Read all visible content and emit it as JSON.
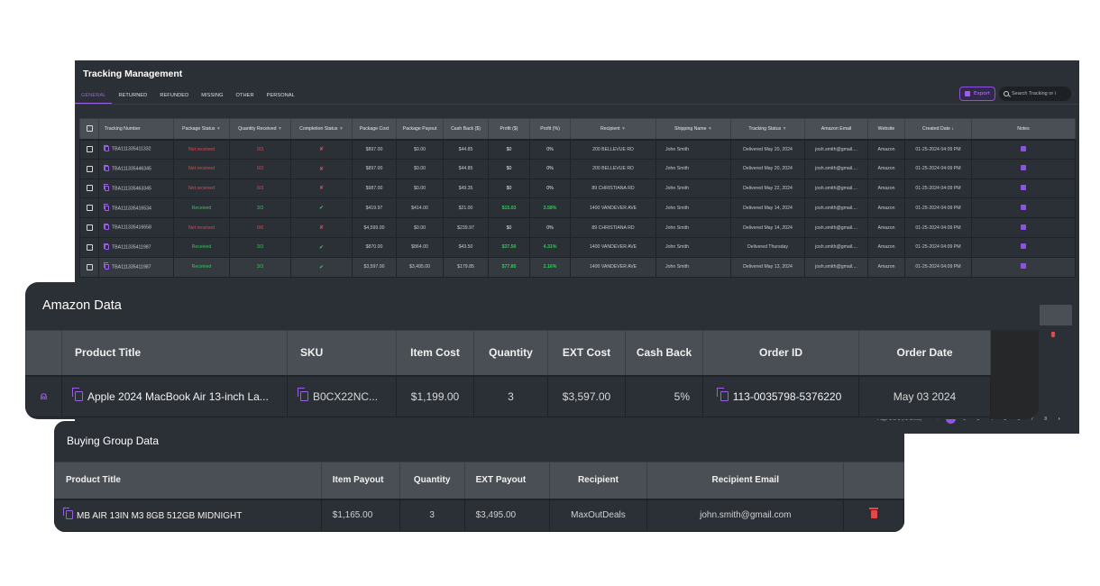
{
  "tracking": {
    "title": "Tracking Management",
    "tabs": [
      {
        "label": "GENERAL",
        "active": true
      },
      {
        "label": "RETURNED",
        "active": false
      },
      {
        "label": "REFUNDED",
        "active": false
      },
      {
        "label": "MISSING",
        "active": false
      },
      {
        "label": "OTHER",
        "active": false
      },
      {
        "label": "PERSONAL",
        "active": false
      }
    ],
    "export_label": "Export",
    "search_placeholder": "Search Tracking or i",
    "columns": [
      "Tracking Number",
      "Package Status",
      "Quantity Received",
      "Completion Status",
      "Package Cost",
      "Package Payout",
      "Cash Back ($)",
      "Profit ($)",
      "Profit (%)",
      "Recipient",
      "Shipping Name",
      "Tracking Status",
      "Amazon Email",
      "Website",
      "Created Date",
      "Notes"
    ],
    "filter_icon": "filter-icon",
    "sort_icon": "↓",
    "rows": [
      {
        "tracking": "TBA111335411332",
        "status": "Not received",
        "qty": "0/3",
        "complete": false,
        "cost": "$897.00",
        "payout": "$0.00",
        "cashback": "$44.85",
        "profit": "$0",
        "profit_pct": "0%",
        "recipient": "200 BELLEVUE RD",
        "ship_name": "John Smith",
        "track_status": "Delivered May 20, 2024",
        "email": "josh.smith@gmail....",
        "website": "Amazon",
        "created": "01-25-2024 04:09 PM"
      },
      {
        "tracking": "TBA111335446345",
        "status": "Not received",
        "qty": "0/3",
        "complete": false,
        "cost": "$897.00",
        "payout": "$0.00",
        "cashback": "$44.85",
        "profit": "$0",
        "profit_pct": "0%",
        "recipient": "200 BELLEVUE RD",
        "ship_name": "John Smith",
        "track_status": "Delivered May 20, 2024",
        "email": "josh.smith@gmail....",
        "website": "Amazon",
        "created": "01-25-2024 04:09 PM"
      },
      {
        "tracking": "TBA111335463345",
        "status": "Not received",
        "qty": "0/3",
        "complete": false,
        "cost": "$987.00",
        "payout": "$0.00",
        "cashback": "$49.35",
        "profit": "$0",
        "profit_pct": "0%",
        "recipient": "89 CHRISTIANA RD",
        "ship_name": "John Smith",
        "track_status": "Delivered May 22, 2024",
        "email": "josh.smith@gmail....",
        "website": "Amazon",
        "created": "01-25-2024 04:09 PM"
      },
      {
        "tracking": "TBA111335416534",
        "status": "Received",
        "qty": "3/3",
        "complete": true,
        "cost": "$419.97",
        "payout": "$414.00",
        "cashback": "$21.00",
        "profit": "$15.03",
        "profit_pct": "3.58%",
        "recipient": "1400 VANDEVER AVE",
        "ship_name": "John Smith",
        "track_status": "Delivered May 14, 2024",
        "email": "josh.smith@gmail....",
        "website": "Amazon",
        "created": "01-25-2024 04:09 PM"
      },
      {
        "tracking": "TBA111335416658",
        "status": "Not received",
        "qty": "0/6",
        "complete": false,
        "cost": "$4,599.00",
        "payout": "$0.00",
        "cashback": "$239.97",
        "profit": "$0",
        "profit_pct": "0%",
        "recipient": "89 CHRISTIANA RD",
        "ship_name": "John Smith",
        "track_status": "Delivered May 14, 2024",
        "email": "josh.smith@gmail....",
        "website": "Amazon",
        "created": "01-25-2024 04:09 PM"
      },
      {
        "tracking": "TBA111335411987",
        "status": "Received",
        "qty": "3/3",
        "complete": true,
        "cost": "$870.00",
        "payout": "$864.00",
        "cashback": "$43.50",
        "profit": "$37.50",
        "profit_pct": "4.31%",
        "recipient": "1400 VANDEVER AVE",
        "ship_name": "John Smith",
        "track_status": "Delivered Thursday",
        "email": "josh.smith@gmail....",
        "website": "Amazon",
        "created": "01-25-2024 04:09 PM"
      },
      {
        "tracking": "TBA111335411987",
        "status": "Received",
        "qty": "3/3",
        "complete": true,
        "cost": "$3,597.00",
        "payout": "$3,495.00",
        "cashback": "$179.85",
        "profit": "$77.85",
        "profit_pct": "2.16%",
        "recipient": "1400 VANDEVER AVE",
        "ship_name": "John Smith",
        "track_status": "Delivered May 13, 2024",
        "email": "josh.smith@gmail....",
        "website": "Amazon",
        "created": "01-25-2024 04:09 PM"
      }
    ],
    "pagination": {
      "info": "Page 1 of 8 (72 items)",
      "prev": "‹",
      "next": "›",
      "pages": [
        "1",
        "2",
        "3",
        "4",
        "5",
        "6",
        "7",
        "8"
      ],
      "current": "1"
    }
  },
  "amazon": {
    "title": "Amazon Data",
    "columns": [
      "",
      "Product Title",
      "SKU",
      "Item Cost",
      "Quantity",
      "EXT Cost",
      "Cash Back",
      "Order ID",
      "Order Date"
    ],
    "row": {
      "product_title": "Apple 2024 MacBook Air 13-inch La...",
      "sku": "B0CX22NC...",
      "item_cost": "$1,199.00",
      "quantity": "3",
      "ext_cost": "$3,597.00",
      "cash_back": "5%",
      "order_id": "113-0035798-5376220",
      "order_date": "May 03 2024"
    }
  },
  "buying_group": {
    "title": "Buying Group Data",
    "columns": [
      "Product Title",
      "Item Payout",
      "Quantity",
      "EXT Payout",
      "Recipient",
      "Recipient Email",
      ""
    ],
    "row": {
      "product_title": "MB AIR 13IN M3 8GB 512GB MIDNIGHT",
      "item_payout": "$1,165.00",
      "quantity": "3",
      "ext_payout": "$3,495.00",
      "recipient": "MaxOutDeals",
      "recipient_email": "john.smith@gmail.com"
    }
  },
  "colors": {
    "accent": "#9a5ee8",
    "error": "#e24a4a",
    "success": "#2ecc55",
    "panel_bg": "#2b2f36",
    "header_bg": "#4a4f55"
  }
}
